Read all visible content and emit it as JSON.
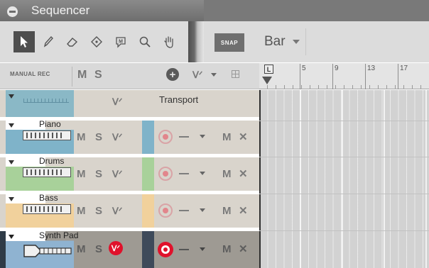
{
  "window": {
    "title": "Sequencer"
  },
  "toolbar": {
    "tools": [
      {
        "name": "arrow-tool",
        "glyph": "➤",
        "active": true
      },
      {
        "name": "pencil-tool",
        "glyph": "✎",
        "active": false
      },
      {
        "name": "eraser-tool",
        "glyph": "⌫",
        "active": false
      },
      {
        "name": "razor-tool",
        "glyph": "◇",
        "active": false
      },
      {
        "name": "mute-tool",
        "glyph": "M",
        "active": false
      },
      {
        "name": "magnify-tool",
        "glyph": "⚲",
        "active": false
      },
      {
        "name": "hand-tool",
        "glyph": "✋",
        "active": false
      }
    ],
    "snap_label": "SNAP",
    "snap_value": "Bar"
  },
  "header": {
    "manual_rec": "MANUAL REC",
    "mute": "M",
    "solo": "S"
  },
  "ruler": {
    "left_marker": "L",
    "bars": [
      "5",
      "9",
      "13",
      "17"
    ]
  },
  "transport": {
    "label": "Transport"
  },
  "tracks": [
    {
      "name": "Piano",
      "color": "#7fb3c9",
      "selected": false
    },
    {
      "name": "Drums",
      "color": "#a8d19a",
      "selected": false
    },
    {
      "name": "Bass",
      "color": "#f1d19c",
      "selected": false
    },
    {
      "name": "Synth Pad",
      "color": "#8fb3d1",
      "selected": true
    }
  ],
  "track_controls": {
    "mute": "M",
    "solo": "S",
    "close": "✕"
  }
}
